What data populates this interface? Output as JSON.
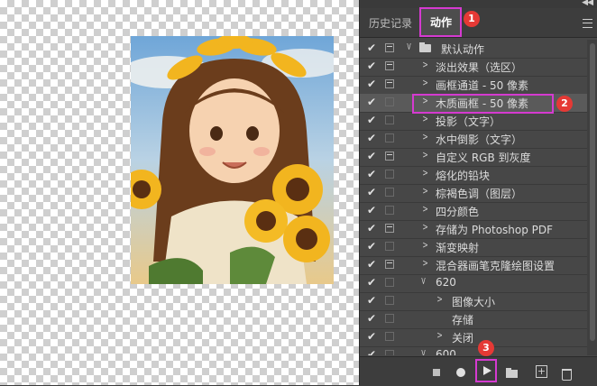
{
  "panel": {
    "tabs": [
      {
        "label": "历史记录"
      },
      {
        "label": "动作"
      }
    ]
  },
  "actions": [
    {
      "label": "默认动作"
    },
    {
      "label": "淡出效果（选区）"
    },
    {
      "label": "画框通道 - 50 像素"
    },
    {
      "label": "木质画框 - 50 像素"
    },
    {
      "label": "投影（文字）"
    },
    {
      "label": "水中倒影（文字）"
    },
    {
      "label": "自定义 RGB 到灰度"
    },
    {
      "label": "熔化的铅块"
    },
    {
      "label": "棕褐色调（图层）"
    },
    {
      "label": "四分颜色"
    },
    {
      "label": "存储为 Photoshop PDF"
    },
    {
      "label": "渐变映射"
    },
    {
      "label": "混合器画笔克隆绘图设置"
    },
    {
      "label": "620"
    },
    {
      "label": "图像大小"
    },
    {
      "label": "存储"
    },
    {
      "label": "关闭"
    },
    {
      "label": "600"
    }
  ],
  "annotations": {
    "badge1": "1",
    "badge2": "2",
    "badge3": "3"
  },
  "colors": {
    "highlight": "#d53ad0",
    "badge": "#e53935",
    "panel_bg": "#474747"
  }
}
